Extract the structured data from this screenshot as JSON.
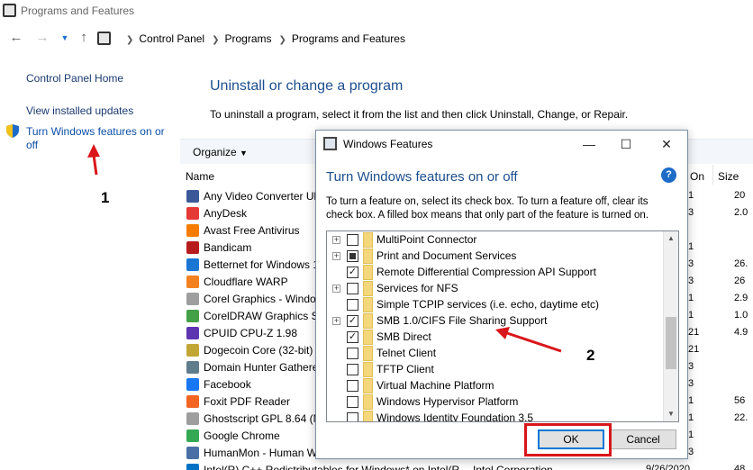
{
  "window": {
    "title": "Programs and Features"
  },
  "address": {
    "crumbs": [
      "Control Panel",
      "Programs",
      "Programs and Features"
    ],
    "back_icon": "arrow-left-icon",
    "forward_icon": "arrow-right-icon",
    "up_icon": "arrow-up-icon"
  },
  "sidebar": {
    "items": [
      "Control Panel Home",
      "View installed updates",
      "Turn Windows features on or off"
    ]
  },
  "main": {
    "heading": "Uninstall or change a program",
    "subtext": "To uninstall a program, select it from the list and then click Uninstall, Change, or Repair.",
    "organize_label": "Organize",
    "columns": {
      "name": "Name",
      "on": "On",
      "size": "Size"
    },
    "programs": [
      {
        "name": "Any Video Converter Ul",
        "on": "1",
        "size": "20",
        "color": "#3b5998"
      },
      {
        "name": "AnyDesk",
        "on": "3",
        "size": "2.0",
        "color": "#e53935"
      },
      {
        "name": "Avast Free Antivirus",
        "on": "",
        "size": "",
        "color": "#f57c00"
      },
      {
        "name": "Bandicam",
        "on": "1",
        "size": "",
        "color": "#b71c1c"
      },
      {
        "name": "Betternet for Windows 1",
        "on": "3",
        "size": "26.",
        "color": "#1976d2"
      },
      {
        "name": "Cloudflare WARP",
        "on": "3",
        "size": "26",
        "color": "#f4811f"
      },
      {
        "name": "Corel Graphics - Windo",
        "on": "1",
        "size": "2.9",
        "color": "#9e9e9e"
      },
      {
        "name": "CorelDRAW Graphics Su",
        "on": "1",
        "size": "1.0",
        "color": "#43a047"
      },
      {
        "name": "CPUID CPU-Z 1.98",
        "on": "21",
        "size": "4.9",
        "color": "#5e35b1"
      },
      {
        "name": "Dogecoin Core (32-bit)",
        "on": "21",
        "size": "",
        "color": "#c2a633"
      },
      {
        "name": "Domain Hunter Gathere",
        "on": "3",
        "size": "",
        "color": "#607d8b"
      },
      {
        "name": "Facebook",
        "on": "3",
        "size": "",
        "color": "#1877f2"
      },
      {
        "name": "Foxit PDF Reader",
        "on": "1",
        "size": "56",
        "color": "#f26522"
      },
      {
        "name": "Ghostscript GPL 8.64 (M",
        "on": "1",
        "size": "22.",
        "color": "#9e9e9e"
      },
      {
        "name": "Google Chrome",
        "on": "1",
        "size": "",
        "color": "#34a853"
      },
      {
        "name": "HumanMon - Human W",
        "on": "3",
        "size": "",
        "color": "#4a6fa5"
      },
      {
        "name": "Intel(R) C++ Redistributables for Windows* on Intel(R",
        "on": "9/26/2020",
        "size": "48",
        "publisher": "Intel Corporation",
        "color": "#0071c5"
      }
    ]
  },
  "dialog": {
    "title": "Windows Features",
    "heading": "Turn Windows features on or off",
    "description": "To turn a feature on, select its check box. To turn a feature off, clear its check box. A filled box means that only part of the feature is turned on.",
    "features": [
      {
        "name": "MultiPoint Connector",
        "expandable": true,
        "state": "off"
      },
      {
        "name": "Print and Document Services",
        "expandable": true,
        "state": "partial"
      },
      {
        "name": "Remote Differential Compression API Support",
        "expandable": false,
        "state": "on"
      },
      {
        "name": "Services for NFS",
        "expandable": true,
        "state": "off"
      },
      {
        "name": "Simple TCPIP services (i.e. echo, daytime etc)",
        "expandable": false,
        "state": "off"
      },
      {
        "name": "SMB 1.0/CIFS File Sharing Support",
        "expandable": true,
        "state": "on"
      },
      {
        "name": "SMB Direct",
        "expandable": false,
        "state": "on"
      },
      {
        "name": "Telnet Client",
        "expandable": false,
        "state": "off"
      },
      {
        "name": "TFTP Client",
        "expandable": false,
        "state": "off"
      },
      {
        "name": "Virtual Machine Platform",
        "expandable": false,
        "state": "off"
      },
      {
        "name": "Windows Hypervisor Platform",
        "expandable": false,
        "state": "off"
      },
      {
        "name": "Windows Identity Foundation 3.5",
        "expandable": false,
        "state": "off"
      }
    ],
    "ok_label": "OK",
    "cancel_label": "Cancel",
    "minimize_glyph": "—",
    "maximize_glyph": "☐",
    "close_glyph": "✕",
    "help_glyph": "?"
  },
  "annotations": {
    "label_1": "1",
    "label_2": "2",
    "color": "#d9161b"
  },
  "colors": {
    "link": "#1c4f8f",
    "accent": "#0078d7",
    "folder": "#f5d77b"
  }
}
